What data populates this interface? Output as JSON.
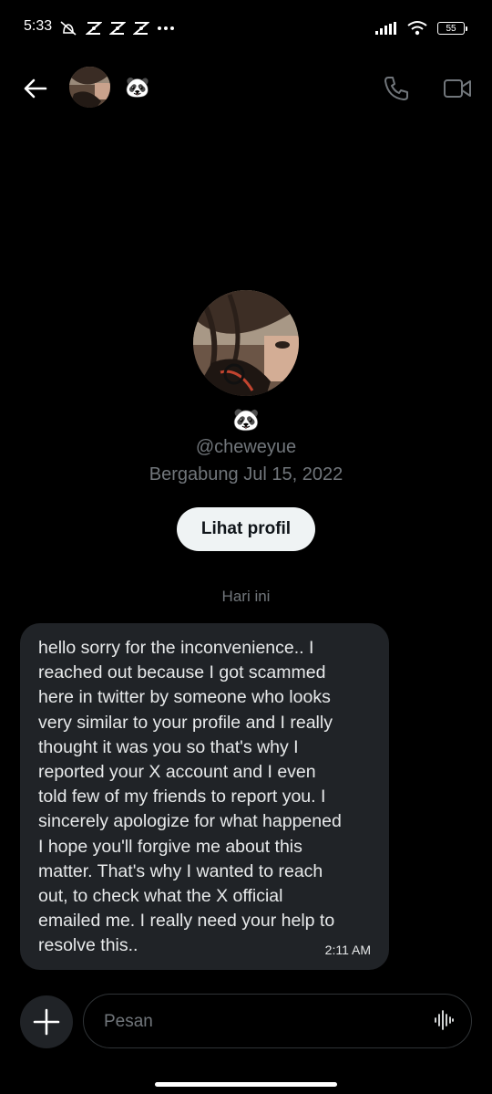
{
  "status_bar": {
    "time": "5:33",
    "battery": "55"
  },
  "header": {
    "name": "🐼"
  },
  "profile": {
    "name": "🐼",
    "handle": "@cheweyue",
    "joined": "Bergabung Jul 15, 2022",
    "view_profile_label": "Lihat profil"
  },
  "conversation": {
    "day_separator": "Hari ini",
    "messages": [
      {
        "text": "hello sorry for the inconvenience.. I\nreached out because I got scammed\nhere in twitter by someone who looks\nvery similar to your profile and I really\nthought it was you so that's why I\nreported your X account and I even\ntold few of my friends to report you. I\nsincerely apologize for what happened\nI hope you'll forgive me about this\nmatter. That's why I wanted to reach\nout, to check what the X official\nemailed me. I really need your help to\nresolve this..",
        "time": "2:11 AM"
      }
    ]
  },
  "composer": {
    "placeholder": "Pesan"
  },
  "icons": {
    "back": "arrow-left-icon",
    "call": "phone-icon",
    "video": "video-camera-icon",
    "add": "plus-icon",
    "voice": "waveform-icon"
  },
  "colors": {
    "background": "#000000",
    "bubble": "#202327",
    "muted": "#71767b",
    "button": "#eff3f4"
  }
}
